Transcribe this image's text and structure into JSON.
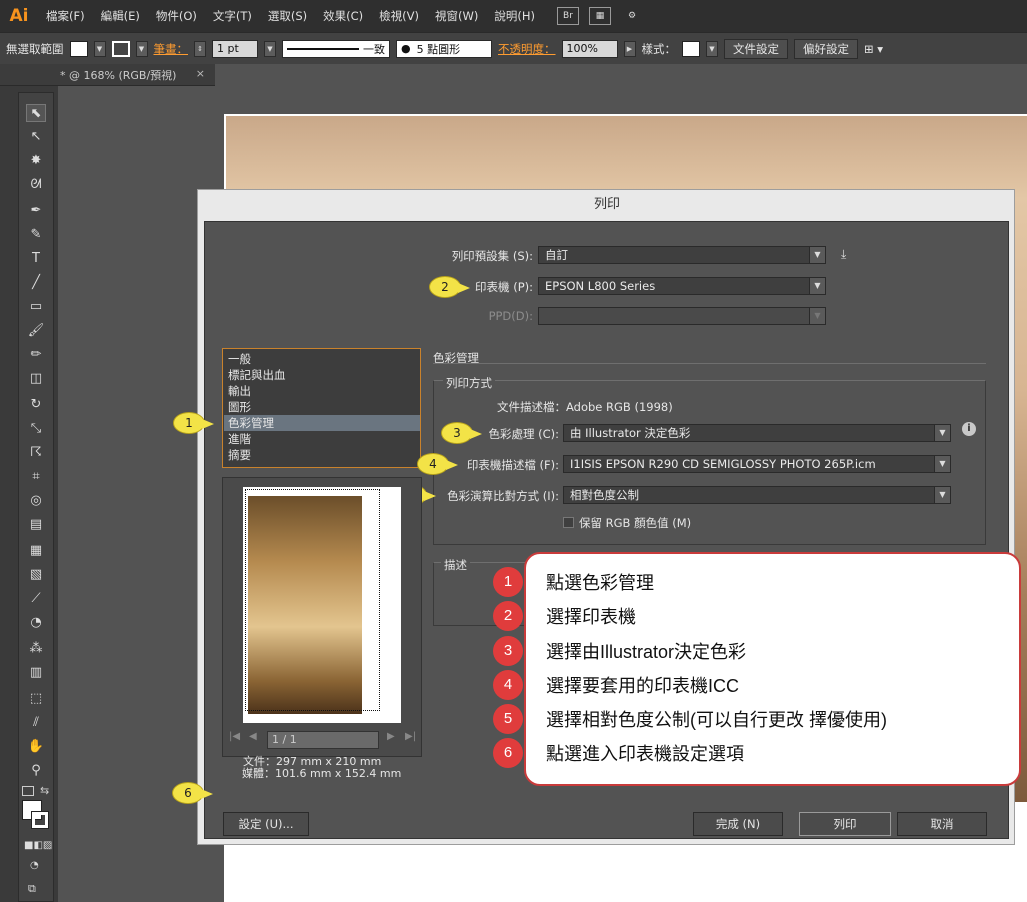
{
  "app": {
    "logo": "Ai"
  },
  "menubar": {
    "items": [
      "檔案(F)",
      "編輯(E)",
      "物件(O)",
      "文字(T)",
      "選取(S)",
      "效果(C)",
      "檢視(V)",
      "視窗(W)",
      "說明(H)"
    ],
    "bridge_icon": "Br"
  },
  "controlbar": {
    "no_selection": "無選取範圍",
    "stroke_label": "筆畫：",
    "stroke_value": "1 pt",
    "stroke_profile": "一致",
    "brush_label": "5 點圓形",
    "opacity_label": "不透明度：",
    "opacity_value": "100%",
    "style_label": "樣式：",
    "doc_setup": "文件設定",
    "preferences": "偏好設定"
  },
  "doctab": {
    "title": "* @ 168% (RGB/預視)",
    "close": "×"
  },
  "dialog": {
    "title": "列印",
    "preset_label": "列印預設集 (S):",
    "preset_value": "自訂",
    "printer_label": "印表機 (P):",
    "printer_value": "EPSON L800 Series",
    "ppd_label": "PPD(D):",
    "ppd_value": "",
    "categories": [
      "一般",
      "標記與出血",
      "輸出",
      "圖形",
      "色彩管理",
      "進階",
      "摘要"
    ],
    "selected_category": "色彩管理",
    "section_title": "色彩管理",
    "print_method_title": "列印方式",
    "doc_profile": "文件描述檔：Adobe RGB (1998)",
    "color_handling_label": "色彩處理 (C):",
    "color_handling_value": "由 Illustrator 決定色彩",
    "printer_profile_label": "印表機描述檔 (F):",
    "printer_profile_value": "I1ISIS EPSON R290 CD SEMIGLOSSY PHOTO 265P.icm",
    "rendering_intent_label": "色彩演算比對方式 (I):",
    "rendering_intent_value": "相對色度公制",
    "preserve_rgb": "保留 RGB 顏色值 (M)",
    "description_title": "描述",
    "pager": "1 / 1",
    "doc_size": "文件：297 mm x 210 mm",
    "media_size": "媒體：101.6 mm x 152.4 mm",
    "setup_button": "設定 (U)...",
    "done_button": "完成 (N)",
    "print_button": "列印",
    "cancel_button": "取消"
  },
  "badges": [
    "1",
    "2",
    "3",
    "4",
    "5",
    "6"
  ],
  "callout": {
    "steps": [
      {
        "num": "1",
        "text": "點選色彩管理"
      },
      {
        "num": "2",
        "text": "選擇印表機"
      },
      {
        "num": "3",
        "text": "選擇由Illustrator決定色彩"
      },
      {
        "num": "4",
        "text": "選擇要套用的印表機ICC"
      },
      {
        "num": "5",
        "text": "選擇相對色度公制(可以自行更改 擇優使用)"
      },
      {
        "num": "6",
        "text": "點選進入印表機設定選項"
      }
    ]
  },
  "colors": {
    "callout_border": "#c93b3b",
    "step_badge": "#e03c3c",
    "yellow_badge": "#f3e347",
    "list_border": "#c9822c"
  }
}
